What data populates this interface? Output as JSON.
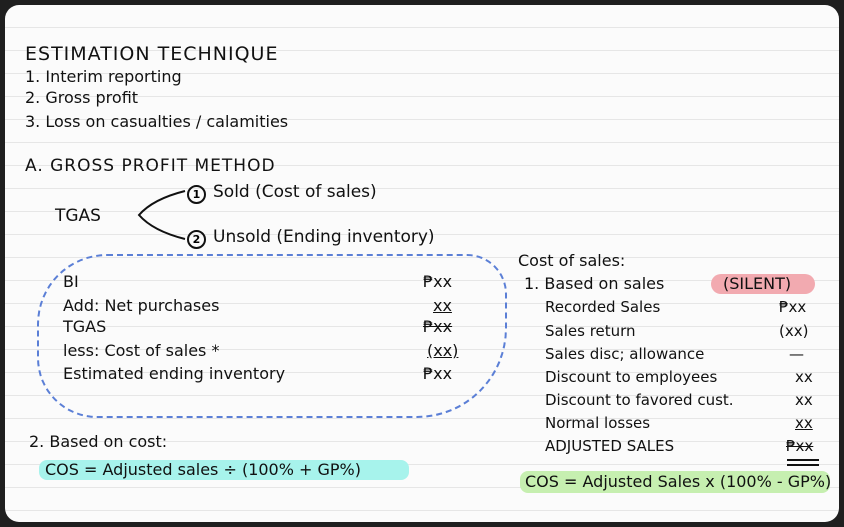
{
  "title": "ESTIMATION TECHNIQUE",
  "uses": [
    "1. Interim reporting",
    "2. Gross profit",
    "3. Loss on casualties / calamities"
  ],
  "section_a": "A. GROSS PROFIT METHOD",
  "tgas": "TGAS",
  "branch_sold": "Sold (Cost of sales)",
  "branch_unsold": "Unsold (Ending inventory)",
  "branch_nums": [
    "1",
    "2"
  ],
  "box": {
    "bi": "BI",
    "bi_val": "₱xx",
    "add": "Add: Net purchases",
    "add_val": "xx",
    "tgas": "TGAS",
    "tgas_val": "₱xx",
    "less": "less: Cost of sales *",
    "less_val": "(xx)",
    "est": "Estimated ending inventory",
    "est_val": "₱xx"
  },
  "based_cost": "2. Based on cost:",
  "cos_formula_cost": "COS = Adjusted sales ÷ (100% + GP%)",
  "right": {
    "heading": "Cost of sales:",
    "based_sales": "1. Based on sales",
    "silent": "(SILENT)",
    "rows": [
      {
        "label": "Recorded Sales",
        "value": "₱xx"
      },
      {
        "label": "Sales return",
        "value": "(xx)"
      },
      {
        "label": "Sales disc; allowance",
        "value": "—"
      },
      {
        "label": "Discount to employees",
        "value": "xx"
      },
      {
        "label": "Discount to favored cust.",
        "value": "xx"
      },
      {
        "label": "Normal losses",
        "value": "xx"
      },
      {
        "label": "ADJUSTED SALES",
        "value": "₱xx"
      }
    ],
    "cos_formula_sales": "COS = Adjusted Sales x (100% - GP%)"
  }
}
